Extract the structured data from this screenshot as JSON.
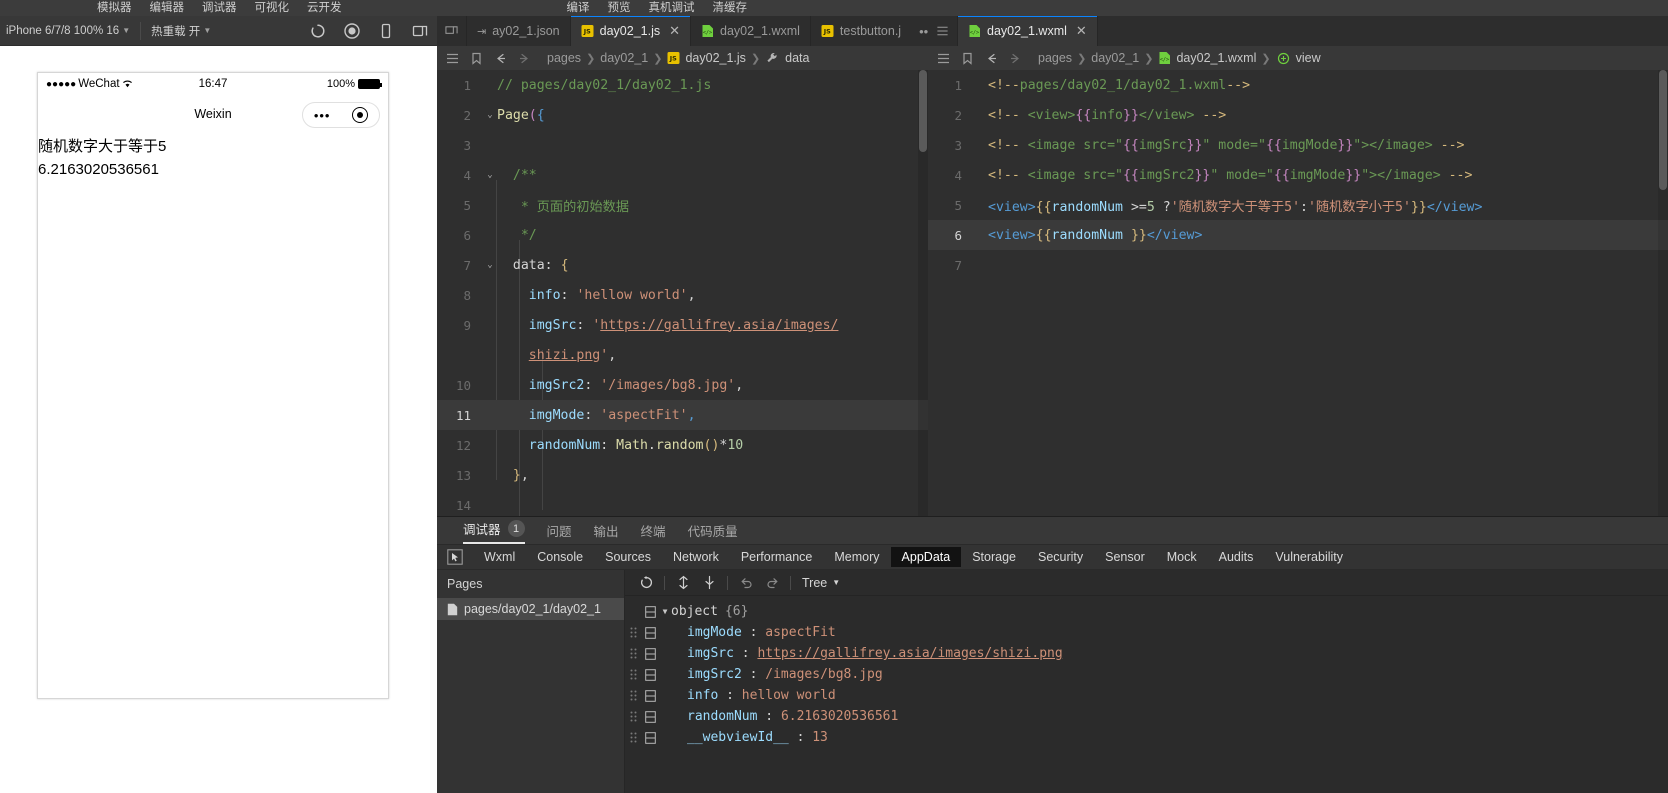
{
  "menubar": {
    "left_items": [
      "模拟器",
      "编辑器",
      "调试器",
      "可视化",
      "云开发"
    ],
    "right_items": [
      "编译",
      "预览",
      "真机调试",
      "清缓存"
    ]
  },
  "simulator_toolbar": {
    "device": "iPhone 6/7/8 100% 16",
    "hot_reload": "热重载 开",
    "icons": [
      "refresh-icon",
      "record-icon",
      "device-icon",
      "detach-icon"
    ]
  },
  "simulator": {
    "status_bar": {
      "carrier_dots": "●●●●●",
      "carrier": "WeChat",
      "wifi": "wifi-icon",
      "time": "16:47",
      "battery_percent": "100%"
    },
    "nav_title": "Weixin",
    "capsule": {
      "more": "•••",
      "target": "target-icon"
    },
    "page_lines": [
      "随机数字大于等于5",
      "6.2163020536561"
    ]
  },
  "editor_js": {
    "tabs": [
      {
        "label": "ay02_1.json",
        "icon": "json-file-icon",
        "active": false,
        "closable": false
      },
      {
        "label": "day02_1.js",
        "icon": "js-file-icon",
        "active": true,
        "closable": true
      },
      {
        "label": "day02_1.wxml",
        "icon": "wxml-file-icon",
        "active": false,
        "closable": false
      },
      {
        "label": "testbutton.j",
        "icon": "js-file-icon",
        "active": false,
        "closable": false
      }
    ],
    "overflow": "•••",
    "breadcrumb": {
      "icons": [
        "outline-icon",
        "bookmark-icon",
        "back-arrow-icon",
        "forward-arrow-icon"
      ],
      "parts": [
        "pages",
        "day02_1",
        "day02_1.js",
        "data"
      ],
      "file_icon": "js-file-icon",
      "symbol_icon": "wrench-icon"
    },
    "lines": [
      {
        "num": "1",
        "fold": "",
        "html": "<span class=\"tk-com\">// pages/day02_1/day02_1.js</span>"
      },
      {
        "num": "2",
        "fold": "⌄",
        "html": "<span class=\"tk-fn\">Page</span><span class=\"tk-br1\">(</span><span class=\"tk-br2\">{</span>"
      },
      {
        "num": "3",
        "fold": "",
        "html": ""
      },
      {
        "num": "4",
        "fold": "⌄",
        "html": "  <span class=\"tk-com\">/**</span>"
      },
      {
        "num": "5",
        "fold": "",
        "html": "   <span class=\"tk-com\">* 页面的初始数据</span>"
      },
      {
        "num": "6",
        "fold": "",
        "html": "   <span class=\"tk-com\">*/</span>"
      },
      {
        "num": "7",
        "fold": "⌄",
        "html": "  <span class=\"tk-prop\">data</span><span class=\"tk-pun\">:</span> <span class=\"tk-br3\">{</span>"
      },
      {
        "num": "8",
        "fold": "",
        "html": "    <span class=\"tk-attr\">info</span><span class=\"tk-pun\">:</span> <span class=\"tk-str\">'hellow world'</span><span class=\"tk-pun\">,</span>"
      },
      {
        "num": "9",
        "fold": "",
        "html": "    <span class=\"tk-attr\">imgSrc</span><span class=\"tk-pun\">:</span> <span class=\"tk-str\">'</span><span class=\"tk-lnk\">https://gallifrey.asia/images/</span>"
      },
      {
        "num": "",
        "fold": "",
        "html": "    <span class=\"tk-lnk\">shizi.png</span><span class=\"tk-str\">'</span><span class=\"tk-pun\">,</span>"
      },
      {
        "num": "10",
        "fold": "",
        "html": "    <span class=\"tk-attr\">imgSrc2</span><span class=\"tk-pun\">:</span> <span class=\"tk-str\">'/images/bg8.jpg'</span><span class=\"tk-pun\">,</span>"
      },
      {
        "num": "11",
        "fold": "",
        "html": "    <span class=\"tk-attr\">imgMode</span><span class=\"tk-pun\">:</span> <span class=\"tk-str\">'aspectFit'</span><span class=\"tk-br2\">,</span>"
      },
      {
        "num": "12",
        "fold": "",
        "html": "    <span class=\"tk-attr\">randomNum</span><span class=\"tk-pun\">:</span> <span class=\"tk-fn\">Math</span><span class=\"tk-pun\">.</span><span class=\"tk-fn\">random</span><span class=\"tk-br3\">()</span><span class=\"tk-pun\">*</span><span class=\"tk-num\">10</span>"
      },
      {
        "num": "13",
        "fold": "",
        "html": "  <span class=\"tk-br3\">}</span><span class=\"tk-pun\">,</span>"
      },
      {
        "num": "14",
        "fold": "",
        "html": ""
      }
    ],
    "highlight_line_index": 11
  },
  "editor_wxml": {
    "tabs": [
      {
        "label": "day02_1.wxml",
        "icon": "wxml-file-icon",
        "active": true,
        "closable": true
      }
    ],
    "breadcrumb": {
      "icons": [
        "outline-icon",
        "bookmark-icon",
        "back-arrow-icon",
        "forward-arrow-icon"
      ],
      "parts": [
        "pages",
        "day02_1",
        "day02_1.wxml",
        "view"
      ],
      "file_icon": "wxml-file-icon",
      "symbol_icon": "view-symbol-icon"
    },
    "lines": [
      {
        "num": "1",
        "html": "<span class=\"tk-xcom\">&lt;!--</span><span class=\"tk-green\">pages/day02_1/day02_1.wxml</span><span class=\"tk-xcom\">--&gt;</span>"
      },
      {
        "num": "2",
        "html": "<span class=\"tk-xcom\">&lt;!-- </span><span class=\"tk-green\">&lt;view&gt;</span><span class=\"tk-mus\">{{</span><span class=\"tk-green\">info</span><span class=\"tk-mus\">}}</span><span class=\"tk-green\">&lt;/view&gt; </span><span class=\"tk-xcom\">--&gt;</span>"
      },
      {
        "num": "3",
        "html": "<span class=\"tk-xcom\">&lt;!-- </span><span class=\"tk-green\">&lt;image src=\"</span><span class=\"tk-mus\">{{</span><span class=\"tk-green\">imgSrc</span><span class=\"tk-mus\">}}</span><span class=\"tk-green\">\" mode=\"</span><span class=\"tk-mus\">{{</span><span class=\"tk-green\">imgMode</span><span class=\"tk-mus\">}}</span><span class=\"tk-green\">\"&gt;&lt;/image&gt; </span><span class=\"tk-xcom\">--&gt;</span>"
      },
      {
        "num": "4",
        "html": "<span class=\"tk-xcom\">&lt;!-- </span><span class=\"tk-green\">&lt;image src=\"</span><span class=\"tk-mus\">{{</span><span class=\"tk-green\">imgSrc2</span><span class=\"tk-mus\">}}</span><span class=\"tk-green\">\" mode=\"</span><span class=\"tk-mus\">{{</span><span class=\"tk-green\">imgMode</span><span class=\"tk-mus\">}}</span><span class=\"tk-green\">\"&gt;&lt;/image&gt; </span><span class=\"tk-xcom\">--&gt;</span>"
      },
      {
        "num": "5",
        "html": "<span class=\"tk-tag\">&lt;view&gt;</span><span class=\"tk-br3\">{{</span><span class=\"tk-attr\">randomNum </span><span class=\"tk-pun\">&gt;=</span><span class=\"tk-num\">5</span> <span class=\"tk-pun\">?</span><span class=\"tk-str\">'随机数字大于等于5'</span><span class=\"tk-pun\">:</span><span class=\"tk-str\">'随机数字小于5'</span><span class=\"tk-br3\">}}</span><span class=\"tk-tag\">&lt;/view&gt;</span>"
      },
      {
        "num": "6",
        "html": "<span class=\"tk-tag\">&lt;view&gt;</span><span class=\"tk-br3\">{{</span><span class=\"tk-attr\">randomNum </span><span class=\"tk-br3\">}}</span><span class=\"tk-tag\">&lt;/view&gt;</span>"
      },
      {
        "num": "7",
        "html": ""
      }
    ],
    "highlight_line_index": 5
  },
  "debugger": {
    "panel_tabs": [
      {
        "label": "调试器",
        "badge": "1",
        "active": true
      },
      {
        "label": "问题",
        "badge": "",
        "active": false
      },
      {
        "label": "输出",
        "badge": "",
        "active": false
      },
      {
        "label": "终端",
        "badge": "",
        "active": false
      },
      {
        "label": "代码质量",
        "badge": "",
        "active": false
      }
    ],
    "devtools_tabs": [
      {
        "label": "Wxml",
        "active": false
      },
      {
        "label": "Console",
        "active": false
      },
      {
        "label": "Sources",
        "active": false
      },
      {
        "label": "Network",
        "active": false
      },
      {
        "label": "Performance",
        "active": false
      },
      {
        "label": "Memory",
        "active": false
      },
      {
        "label": "AppData",
        "active": true
      },
      {
        "label": "Storage",
        "active": false
      },
      {
        "label": "Security",
        "active": false
      },
      {
        "label": "Sensor",
        "active": false
      },
      {
        "label": "Mock",
        "active": false
      },
      {
        "label": "Audits",
        "active": false
      },
      {
        "label": "Vulnerability",
        "active": false
      }
    ],
    "inspect_icon": "cursor-select-icon",
    "pages_pane": {
      "title": "Pages",
      "items": [
        {
          "label": "pages/day02_1/day02_1",
          "selected": true
        }
      ]
    },
    "tree_toolbar": {
      "icons": [
        "refresh-icon",
        "expand-icon",
        "collapse-icon",
        "undo-icon",
        "redo-icon"
      ],
      "mode_label": "Tree",
      "mode_caret": "▼"
    },
    "tree": {
      "root_label": "object",
      "root_count": "{6}",
      "root_disclosure": "▼",
      "rows": [
        {
          "key": "imgMode",
          "value": "aspectFit",
          "link": false
        },
        {
          "key": "imgSrc",
          "value": "https://gallifrey.asia/images/shizi.png",
          "link": true
        },
        {
          "key": "imgSrc2",
          "value": "/images/bg8.jpg",
          "link": false
        },
        {
          "key": "info",
          "value": "hellow world",
          "link": false
        },
        {
          "key": "randomNum",
          "value": "6.2163020536561",
          "link": false
        },
        {
          "key": "__webviewId__",
          "value": "13",
          "link": false
        }
      ]
    }
  },
  "colors": {
    "accent": "#0a84ff",
    "editor_bg": "#2f2f2f",
    "panel_bg": "#383838",
    "comment_green": "#6a9955",
    "string_orange": "#ce9178"
  }
}
